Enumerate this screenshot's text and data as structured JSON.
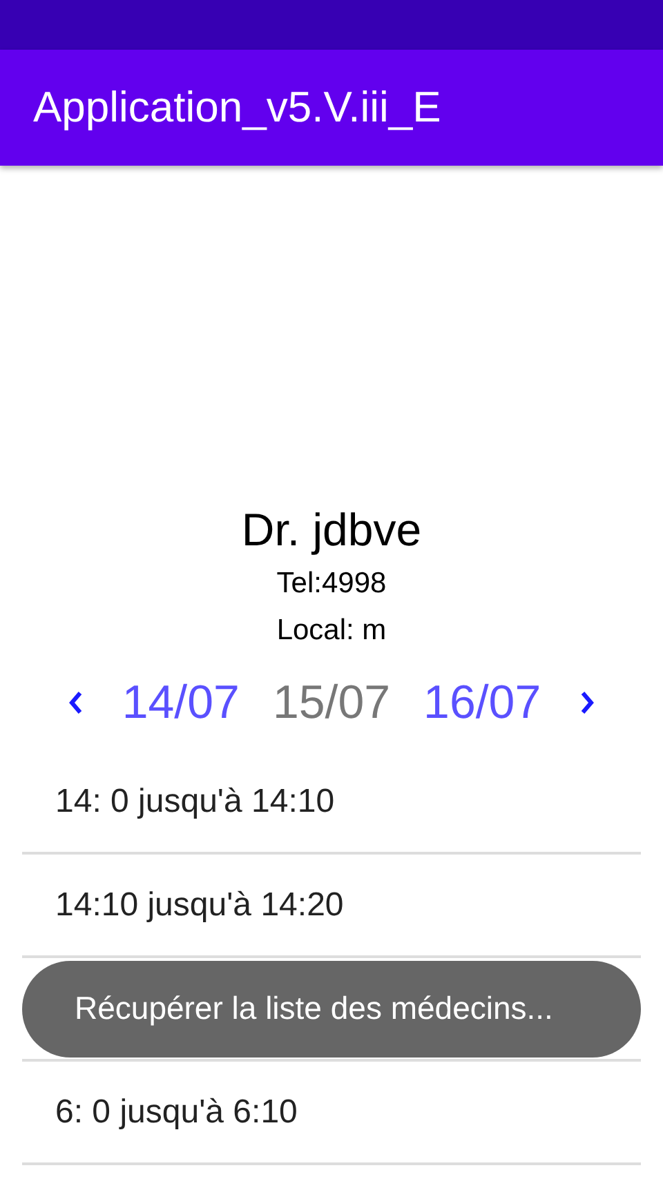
{
  "app_bar": {
    "title": "Application_v5.V.iii_E"
  },
  "doctor": {
    "name": "Dr. jdbve",
    "phone": "Tel:4998",
    "office": "Local: m"
  },
  "dates": [
    {
      "label": "14/07",
      "selected": false
    },
    {
      "label": "15/07",
      "selected": true
    },
    {
      "label": "16/07",
      "selected": false
    }
  ],
  "slots": [
    {
      "kind": "slot",
      "text": "14: 0 jusqu'à 14:10"
    },
    {
      "kind": "slot",
      "text": "14:10 jusqu'à 14:20"
    },
    {
      "kind": "toast",
      "text": "Récupérer la liste des médecins..."
    },
    {
      "kind": "slot",
      "text": "6: 0 jusqu'à 6:10"
    }
  ]
}
